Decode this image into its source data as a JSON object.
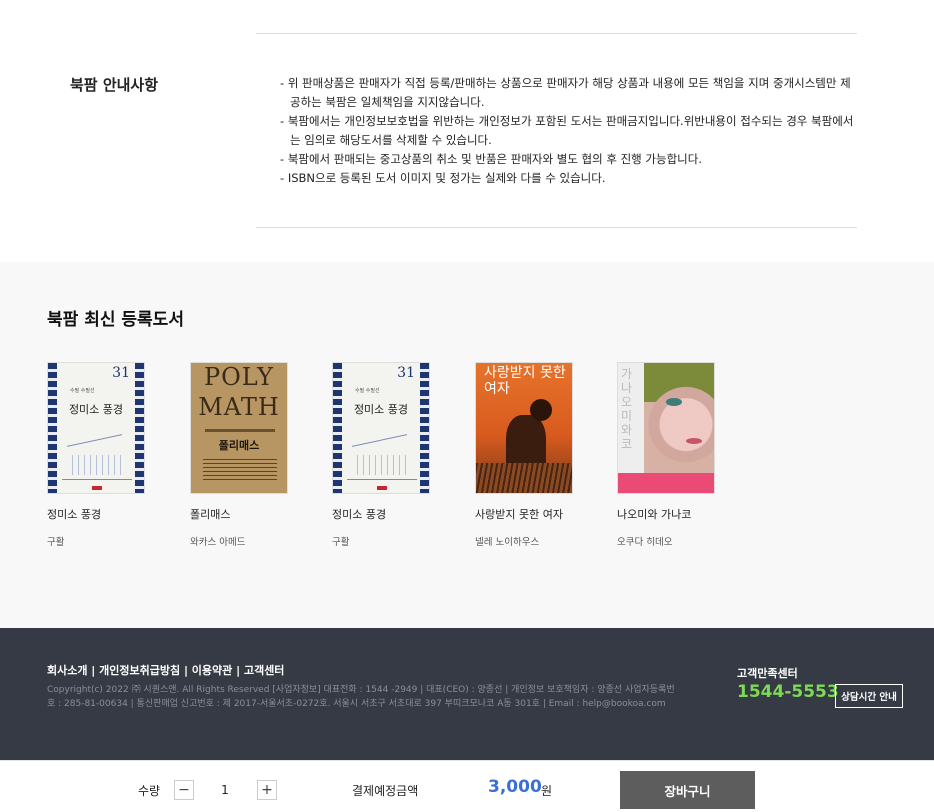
{
  "notice": {
    "title": "북팜 안내사항",
    "items": [
      "위 판매상품은 판매자가 직접 등록/판매하는 상품으로 판매자가 해당 상품과 내용에 모든 책임을 지며 중개시스템만 제공하는 북팜은 일체책임을 지지않습니다.",
      "북팜에서는 개인정보보호법을 위반하는 개인정보가 포함된 도서는 판매금지입니다.위반내용이 접수되는 경우 북팜에서는 임의로 해당도서를 삭제할 수 있습니다.",
      "북팜에서 판매되는 중고상품의 취소 및 반품은 판매자와 별도 협의 후 진행 가능합니다.",
      "ISBN으로 등록된 도서 이미지 및 정가는 실제와 다를 수 있습니다."
    ]
  },
  "recent": {
    "title": "북팜 최신 등록도서",
    "books": [
      {
        "title": "정미소 풍경",
        "author": "구활",
        "cover": {
          "num": "31",
          "sub": "수필 수필선",
          "title": "정미소 풍경"
        }
      },
      {
        "title": "폴리매스",
        "author": "와카스 아메드",
        "cover": {
          "line1": "POLY",
          "line2": "MATH",
          "title": "폴리매스"
        }
      },
      {
        "title": "정미소 풍경",
        "author": "구활",
        "cover": {
          "num": "31",
          "sub": "수필 수필선",
          "title": "정미소 풍경"
        }
      },
      {
        "title": "사랑받지 못한 여자",
        "author": "넬레 노이하우스",
        "cover": {
          "title": "사랑받지 못한 여자"
        }
      },
      {
        "title": "나오미와 가나코",
        "author": "오쿠다 히데오",
        "cover": {
          "title": "가나오미와코"
        }
      }
    ]
  },
  "footer": {
    "links": "회사소개 | 개인정보취급방침 | 이용약관 | 고객센터",
    "info": "Copyright(c) 2022 ㈜ 시퀀스앤. All Rights Reserved [사업자정보] 대표전화 : 1544 -2949 | 대표(CEO) : 양종선 | 개인정보 보호책임자 : 양종선 사업자등록번호 : 285-81-00634 | 통신판매업 신고번호 : 제 2017-서울서초-0272호. 서울시 서초구 서초대로 397 부띠크모나코 A동 301호 | Email : help@bookoa.com",
    "cs_label": "고객만족센터",
    "cs_phone": "1544-5553",
    "cs_hours_button": "상담시간 안내"
  },
  "purchase": {
    "qty_label": "수량",
    "qty_minus": "−",
    "qty_value": "1",
    "qty_plus": "+",
    "pay_label": "결제예정금액",
    "amount": "3,000",
    "unit": "원",
    "cart_button": "장바구니"
  },
  "colors": {
    "footer_bg": "#353a44",
    "phone_green": "#7ed957",
    "amount_blue": "#3a6fd8",
    "cart_button_bg": "#5d5d5d",
    "recent_bg": "#f8f8f8"
  }
}
